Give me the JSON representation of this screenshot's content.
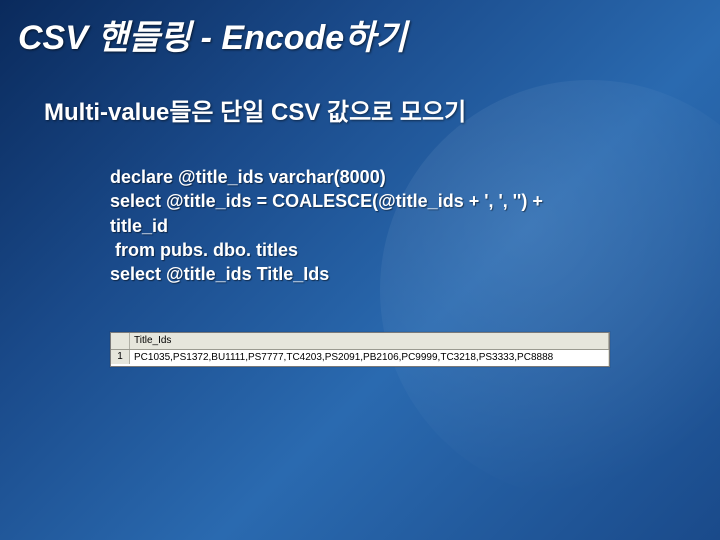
{
  "title": "CSV 핸들링 - Encode하기",
  "subtitle": "Multi-value들은 단일 CSV 값으로 모으기",
  "code": "declare @title_ids varchar(8000)\nselect @title_ids = COALESCE(@title_ids + ', ', '') +\ntitle_id\n from pubs. dbo. titles\nselect @title_ids Title_Ids",
  "result": {
    "header": "Title_Ids",
    "rownum": "1",
    "value": "PC1035,PS1372,BU1111,PS7777,TC4203,PS2091,PB2106,PC9999,TC3218,PS3333,PC8888"
  }
}
